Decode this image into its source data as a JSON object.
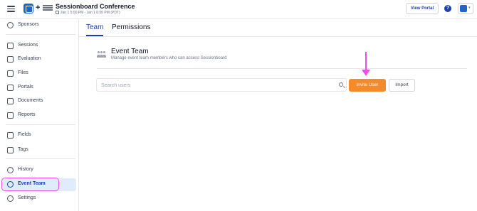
{
  "app": {
    "conference_title": "Sessionboard Conference",
    "conference_dates": "Jan 1 5:00 PM - Jan 1 6:00 PM (PDT)",
    "plus_symbol": "+",
    "view_portal_label": "View Portal",
    "help_symbol": "?"
  },
  "sidebar": {
    "items": [
      {
        "label": "Sponsors",
        "icon": "users-icon"
      },
      {
        "label": "Sessions",
        "icon": "calendar-icon"
      },
      {
        "label": "Evaluation",
        "icon": "evaluation-icon"
      },
      {
        "label": "Files",
        "icon": "play-icon"
      },
      {
        "label": "Portals",
        "icon": "portal-icon"
      },
      {
        "label": "Documents",
        "icon": "document-icon"
      },
      {
        "label": "Reports",
        "icon": "chart-icon"
      },
      {
        "label": "Fields",
        "icon": "fields-icon"
      },
      {
        "label": "Tags",
        "icon": "tag-icon"
      },
      {
        "label": "History",
        "icon": "history-icon"
      },
      {
        "label": "Event Team",
        "icon": "team-icon",
        "active": true
      },
      {
        "label": "Settings",
        "icon": "gear-icon"
      }
    ]
  },
  "tabs": [
    {
      "label": "Team",
      "active": true
    },
    {
      "label": "Permissions"
    }
  ],
  "section": {
    "title": "Event Team",
    "subtitle": "Manage event team members who can access Sessionboard"
  },
  "search": {
    "placeholder": "Search users",
    "value": ""
  },
  "actions": {
    "invite_label": "Invite User",
    "import_label": "Import"
  },
  "colors": {
    "accent": "#1e40af",
    "invite_button": "#f58a2b",
    "annotation": "#ec4ee8",
    "active_nav_bg": "#e0ecfb"
  }
}
